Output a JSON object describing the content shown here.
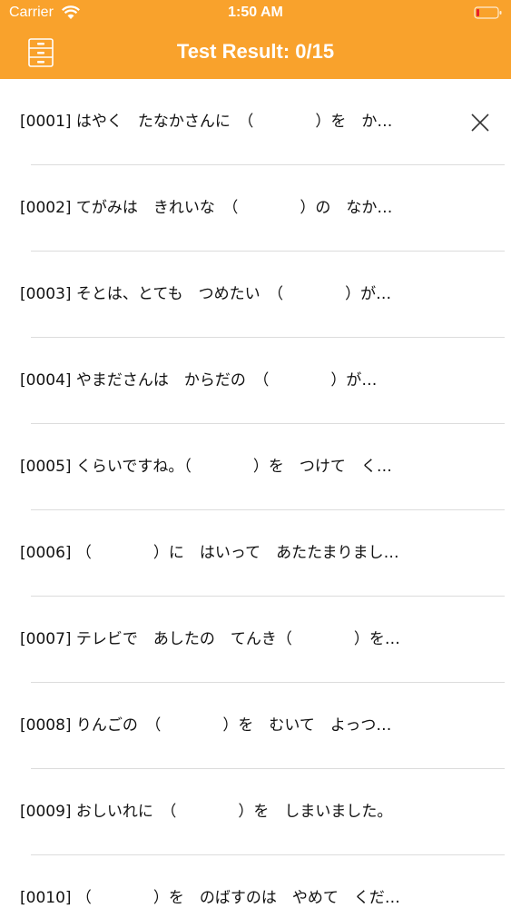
{
  "status_bar": {
    "carrier": "Carrier",
    "time": "1:50 AM",
    "wifi_icon": "wifi-icon",
    "battery_icon": "battery-icon"
  },
  "nav": {
    "title": "Test Result: 0/15",
    "menu_icon": "file-cabinet-icon"
  },
  "colors": {
    "header_bg": "#f9a22c",
    "header_text": "#ffffff",
    "separator": "#dcdcdc"
  },
  "list": {
    "items": [
      {
        "text": "[0001] はやく　たなかさんに　（　　　　）を　か…"
      },
      {
        "text": "[0002] てがみは　きれいな　（　　　　）の　なか…"
      },
      {
        "text": "[0003] そとは、とても　つめたい　（　　　　）が…"
      },
      {
        "text": "[0004] やまださんは　からだの　（　　　　）が…"
      },
      {
        "text": "[0005] くらいですね。（　　　　）を　つけて　く…"
      },
      {
        "text": "[0006] （　　　　）に　はいって　あたたまりまし…"
      },
      {
        "text": "[0007] テレビで　あしたの　てんき（　　　　）を…"
      },
      {
        "text": "[0008] りんごの　（　　　　）を　むいて　よっつ…"
      },
      {
        "text": "[0009] おしいれに　（　　　　）を　しまいました。"
      },
      {
        "text": "[0010] （　　　　）を　のばすのは　やめて　くだ…"
      }
    ]
  }
}
